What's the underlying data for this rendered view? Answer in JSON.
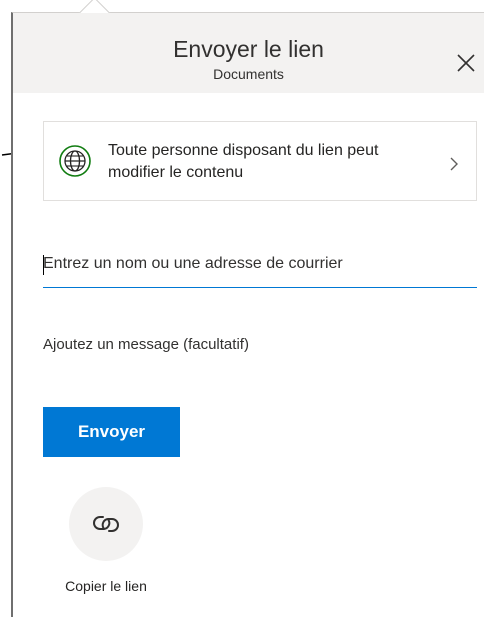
{
  "header": {
    "title": "Envoyer le lien",
    "subtitle": "Documents"
  },
  "permission": {
    "text": "Toute personne disposant du lien peut modifier le contenu",
    "icon": "globe-icon"
  },
  "email_field": {
    "value": "",
    "placeholder": "Entrez un nom ou une adresse de courrier"
  },
  "message_field": {
    "value": "",
    "placeholder": "Ajoutez un message (facultatif)"
  },
  "send_button": {
    "label": "Envoyer"
  },
  "copy_link": {
    "label": "Copier le lien",
    "icon": "link-icon"
  },
  "colors": {
    "accent": "#0078d4",
    "header_bg": "#f3f2f1",
    "globe_green": "#107c10"
  }
}
